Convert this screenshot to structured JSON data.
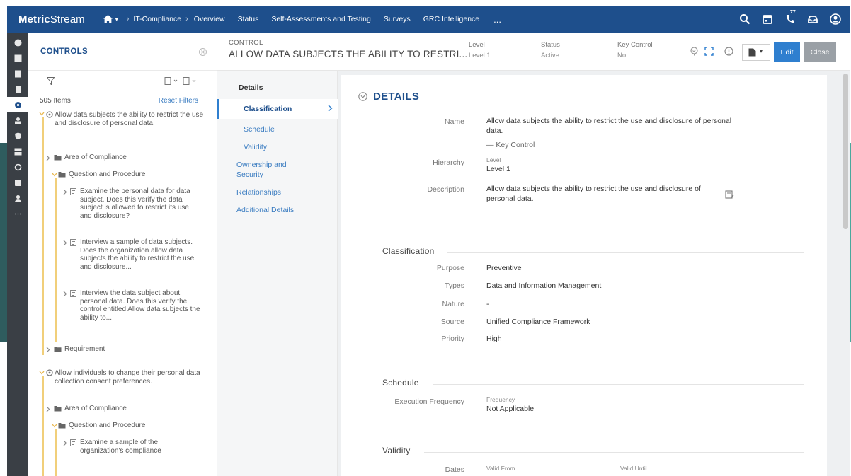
{
  "app": {
    "logo_bold": "Metric",
    "logo_light": "Stream"
  },
  "topnav": {
    "breadcrumb": "IT-Compliance",
    "items": [
      "Overview",
      "Status",
      "Self-Assessments and Testing",
      "Surveys",
      "GRC Intelligence"
    ],
    "more": "...",
    "notification_count": "77"
  },
  "tree": {
    "title": "CONTROLS",
    "count": "505 Items",
    "reset": "Reset Filters",
    "nodes": [
      "Allow data subjects the ability to restrict the use and disclosure of personal data.",
      "Area of Compliance",
      "Question and Procedure",
      "Examine the personal data for data subject. Does this verify the data subject is allowed to restrict its use and disclosure?",
      "Interview a sample of data subjects. Does the organization allow data subjects the ability to restrict the use and disclosure...",
      "Interview the data subject about personal data. Does this verify the control entitled Allow data subjects the ability to...",
      "Requirement",
      "Allow individuals to change their personal data collection consent preferences.",
      "Area of Compliance",
      "Question and Procedure",
      "Examine a sample of the organization's compliance"
    ]
  },
  "record": {
    "label": "CONTROL",
    "title": "ALLOW DATA SUBJECTS THE ABILITY TO RESTRI...",
    "level_label": "Level",
    "level_value": "Level 1",
    "status_label": "Status",
    "status_value": "Active",
    "key_label": "Key Control",
    "key_value": "No",
    "edit": "Edit",
    "close": "Close"
  },
  "sections": {
    "head": "Details",
    "items": [
      "Classification",
      "Schedule",
      "Validity",
      "Ownership and Security",
      "Relationships",
      "Additional Details"
    ]
  },
  "details": {
    "title": "DETAILS",
    "name_label": "Name",
    "name_value": "Allow data subjects the ability to restrict the use and disclosure of personal data.",
    "key_control": "— Key Control",
    "hierarchy_label": "Hierarchy",
    "hierarchy_sub": "Level",
    "hierarchy_value": "Level 1",
    "description_label": "Description",
    "description_value": "Allow data subjects the ability to restrict the use and disclosure of personal data.",
    "classification_title": "Classification",
    "purpose_label": "Purpose",
    "purpose_value": "Preventive",
    "types_label": "Types",
    "types_value": "Data and Information Management",
    "nature_label": "Nature",
    "nature_value": "-",
    "source_label": "Source",
    "source_value": "Unified Compliance Framework",
    "priority_label": "Priority",
    "priority_value": "High",
    "schedule_title": "Schedule",
    "exec_label": "Execution Frequency",
    "freq_sub": "Frequency",
    "freq_value": "Not Applicable",
    "validity_title": "Validity",
    "dates_label": "Dates",
    "valid_from": "Valid From",
    "valid_until": "Valid Until"
  }
}
